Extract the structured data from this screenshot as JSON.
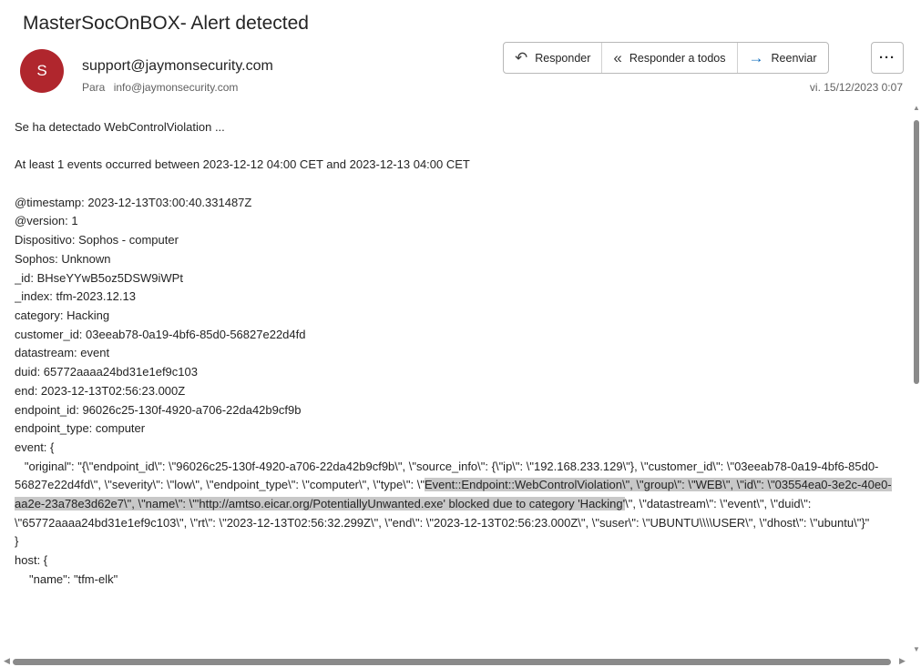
{
  "email": {
    "subject": "MasterSocOnBOX- Alert detected",
    "avatar_initial": "S",
    "avatar_color": "#b0262d",
    "sender": "support@jaymonsecurity.com",
    "to_label": "Para",
    "to_address": "info@jaymonsecurity.com",
    "date": "vi. 15/12/2023 0:07"
  },
  "actions": {
    "reply": "Responder",
    "reply_all": "Responder a todos",
    "forward": "Reenviar",
    "more": "···",
    "reply_icon": "reply-icon",
    "reply_all_icon": "reply-all-icon",
    "forward_icon": "forward-arrow-icon"
  },
  "body": {
    "l1": "Se ha detectado WebControlViolation ...",
    "l2": "At least 1 events occurred between 2023-12-12 04:00 CET and 2023-12-13 04:00 CET",
    "f1": "@timestamp: 2023-12-13T03:00:40.331487Z",
    "f2": "@version: 1",
    "f3": "Dispositivo: Sophos - computer",
    "f4": "Sophos: Unknown",
    "f5": "_id: BHseYYwB5oz5DSW9iWPt",
    "f6": "_index: tfm-2023.12.13",
    "f7": "category: Hacking",
    "f8": "customer_id: 03eeab78-0a19-4bf6-85d0-56827e22d4fd",
    "f9": "datastream: event",
    "f10": "duid: 65772aaaa24bd31e1ef9c103",
    "f11": "end: 2023-12-13T02:56:23.000Z",
    "f12": "endpoint_id: 96026c25-130f-4920-a706-22da42b9cf9b",
    "f13": "endpoint_type: computer",
    "f14": "event: {",
    "ev_a": "\"original\": \"{\\\"endpoint_id\\\": \\\"96026c25-130f-4920-a706-22da42b9cf9b\\\", \\\"source_info\\\": {\\\"ip\\\": \\\"192.168.233.129\\\"}, \\\"customer_id\\\": \\\"03eeab78-0a19-4bf6-85d0-56827e22d4fd\\\", \\\"severity\\\": \\\"low\\\", \\\"endpoint_type\\\": \\\"computer\\\", \\\"type\\\": \\\"",
    "ev_hl": "Event::Endpoint::WebControlViolation\\\", \\\"group\\\": \\\"WEB\\\", \\\"id\\\": \\\"03554ea0-3e2c-40e0-aa2e-23a78e3d62e7\\\", \\\"name\\\": \\\"'http://amtso.eicar.org/PotentiallyUnwanted.exe' blocked due to category 'Hacking'",
    "ev_b": "\\\", \\\"datastream\\\": \\\"event\\\", \\\"duid\\\": \\\"65772aaaa24bd31e1ef9c103\\\", \\\"rt\\\": \\\"2023-12-13T02:56:32.299Z\\\", \\\"end\\\": \\\"2023-12-13T02:56:23.000Z\\\", \\\"suser\\\": \\\"UBUNTU\\\\\\\\USER\\\", \\\"dhost\\\": \\\"ubuntu\\\"}\"",
    "f15": "}",
    "f16": "host: {",
    "f17": "\"name\": \"tfm-elk\""
  }
}
